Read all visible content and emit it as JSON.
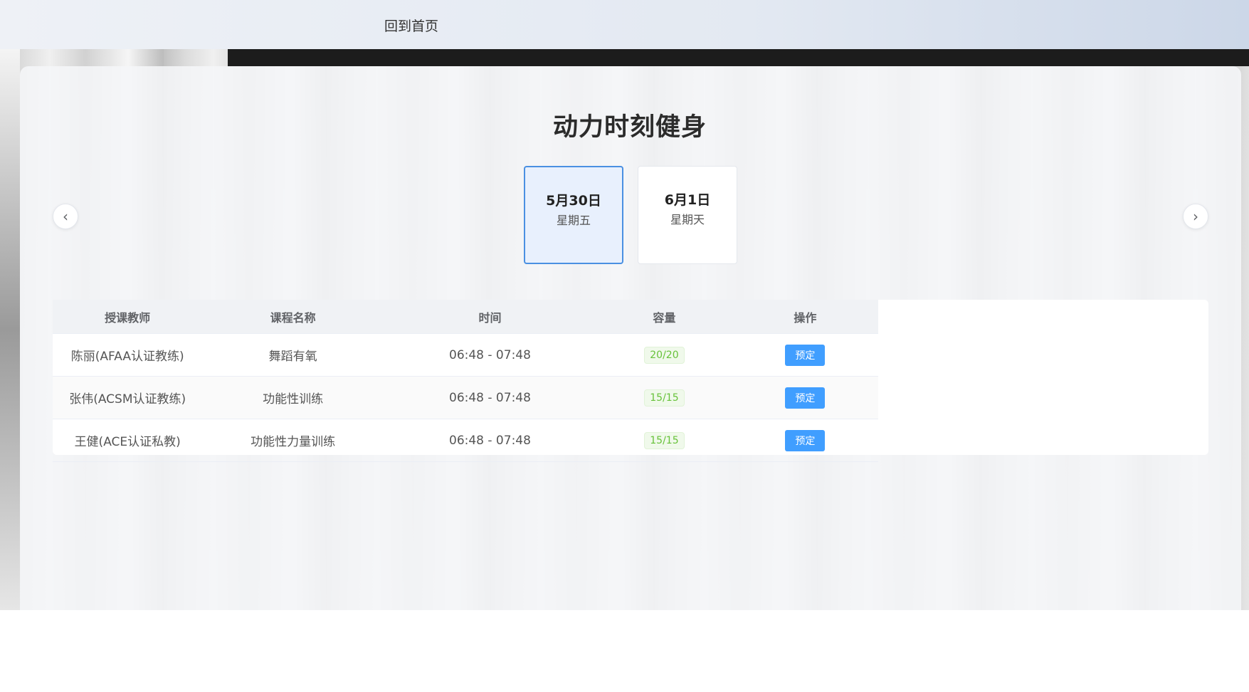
{
  "header": {
    "home_label": "回到首页"
  },
  "page": {
    "title": "动力时刻健身"
  },
  "nav": {
    "prev_icon": "‹",
    "next_icon": "›"
  },
  "dates": [
    {
      "date": "5月30日",
      "weekday": "星期五",
      "selected": true
    },
    {
      "date": "6月1日",
      "weekday": "星期天",
      "selected": false
    }
  ],
  "table": {
    "headers": [
      "授课教师",
      "课程名称",
      "时间",
      "容量",
      "操作"
    ],
    "rows": [
      {
        "teacher": "陈丽(AFAA认证教练)",
        "course": "舞蹈有氧",
        "time": "06:48 - 07:48",
        "capacity": "20/20",
        "action": "预定"
      },
      {
        "teacher": "张伟(ACSM认证教练)",
        "course": "功能性训练",
        "time": "06:48 - 07:48",
        "capacity": "15/15",
        "action": "预定"
      },
      {
        "teacher": "王健(ACE认证私教)",
        "course": "功能性力量训练",
        "time": "06:48 - 07:48",
        "capacity": "15/15",
        "action": "预定"
      }
    ]
  },
  "colors": {
    "accent": "#409eff",
    "selected_card_border": "#4a90e2",
    "capacity_tag": "#67c23a"
  }
}
